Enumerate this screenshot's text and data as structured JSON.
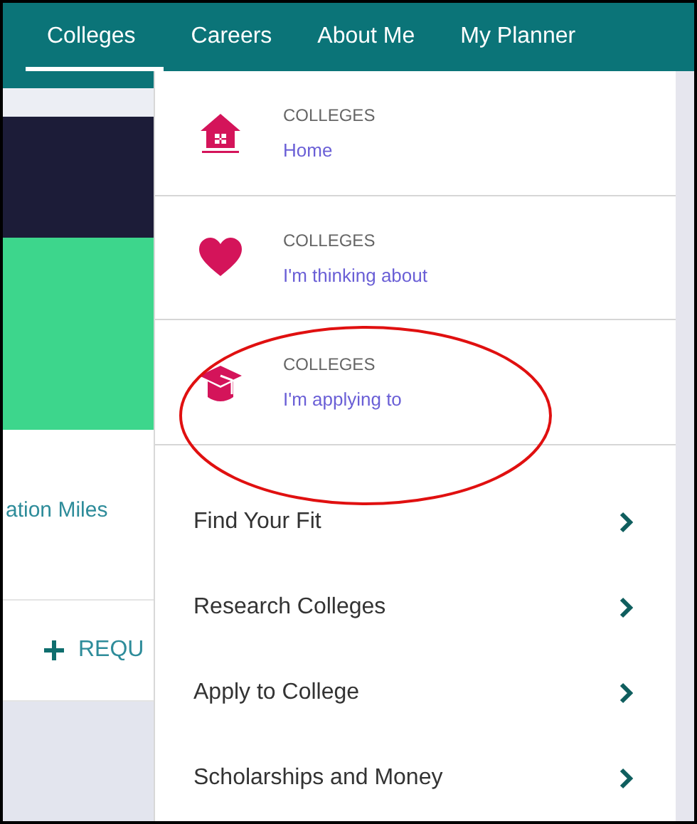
{
  "nav": [
    {
      "label": "Colleges",
      "selected": true
    },
    {
      "label": "Careers",
      "selected": false
    },
    {
      "label": "About Me",
      "selected": false
    },
    {
      "label": "My Planner",
      "selected": false
    }
  ],
  "page": {
    "milestones_text": "ation Miles",
    "request_button": "REQU"
  },
  "dropdown": {
    "college_lists": [
      {
        "kind": "home",
        "category": "COLLEGES",
        "label": "Home"
      },
      {
        "kind": "heart",
        "category": "COLLEGES",
        "label": "I'm thinking about"
      },
      {
        "kind": "cap",
        "category": "COLLEGES",
        "label": "I'm applying to"
      }
    ],
    "links": [
      "Find Your Fit",
      "Research Colleges",
      "Apply to College",
      "Scholarships and Money"
    ]
  }
}
